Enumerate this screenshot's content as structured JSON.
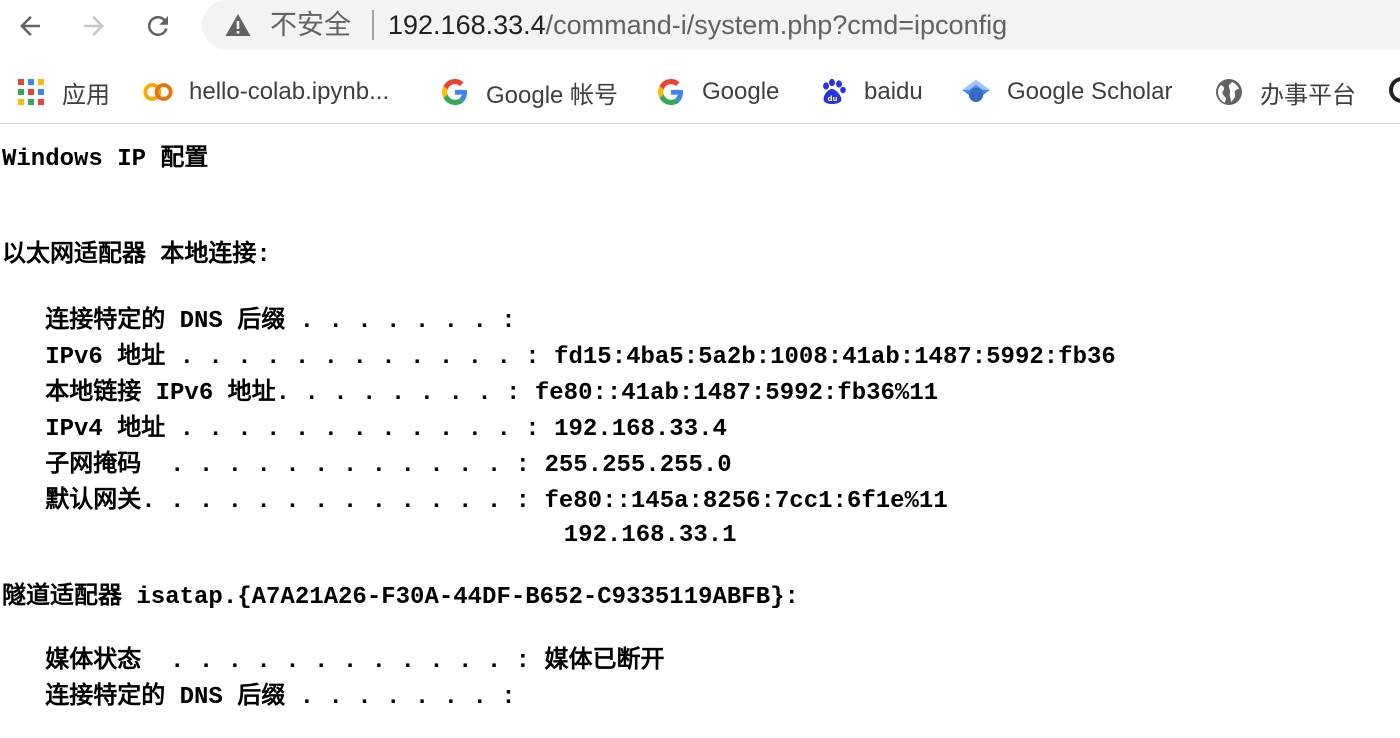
{
  "toolbar": {
    "back_icon": "arrow-left-icon",
    "forward_icon": "arrow-right-icon",
    "reload_icon": "reload-icon",
    "security_icon": "warning-triangle-icon",
    "security_label": "不安全",
    "url_host": "192.168.33.4",
    "url_path": "/command-i/system.php?cmd=ipconfig"
  },
  "bookmarks": [
    {
      "label": "应用",
      "icon": "apps-grid-icon"
    },
    {
      "label": "hello-colab.ipynb...",
      "icon": "colab-icon"
    },
    {
      "label": "Google 帐号",
      "icon": "google-icon"
    },
    {
      "label": "Google",
      "icon": "google-icon"
    },
    {
      "label": "baidu",
      "icon": "baidu-paw-icon"
    },
    {
      "label": "Google Scholar",
      "icon": "scholar-cap-icon"
    },
    {
      "label": "办事平台",
      "icon": "globe-icon"
    }
  ],
  "colors": {
    "google_blue": "#4285F4",
    "google_red": "#EA4335",
    "google_yellow": "#FBBC05",
    "google_green": "#34A853",
    "colab_orange": "#F9AB00",
    "baidu_blue": "#2932E1"
  },
  "output": {
    "heading": "Windows IP 配置",
    "eth_adapter_header": "以太网适配器 本地连接:",
    "eth_lines": [
      "   连接特定的 DNS 后缀 . . . . . . . :",
      "   IPv6 地址 . . . . . . . . . . . . : fd15:4ba5:5a2b:1008:41ab:1487:5992:fb36",
      "   本地链接 IPv6 地址. . . . . . . . : fe80::41ab:1487:5992:fb36%11",
      "   IPv4 地址 . . . . . . . . . . . . : 192.168.33.4",
      "   子网掩码  . . . . . . . . . . . . : 255.255.255.0",
      "   默认网关. . . . . . . . . . . . . : fe80::145a:8256:7cc1:6f1e%11",
      "                                       192.168.33.1"
    ],
    "tunnel_adapter_header": "隧道适配器 isatap.{A7A21A26-F30A-44DF-B652-C9335119ABFB}:",
    "tunnel_lines": [
      "   媒体状态  . . . . . . . . . . . . : 媒体已断开",
      "   连接特定的 DNS 后缀 . . . . . . . :"
    ]
  }
}
